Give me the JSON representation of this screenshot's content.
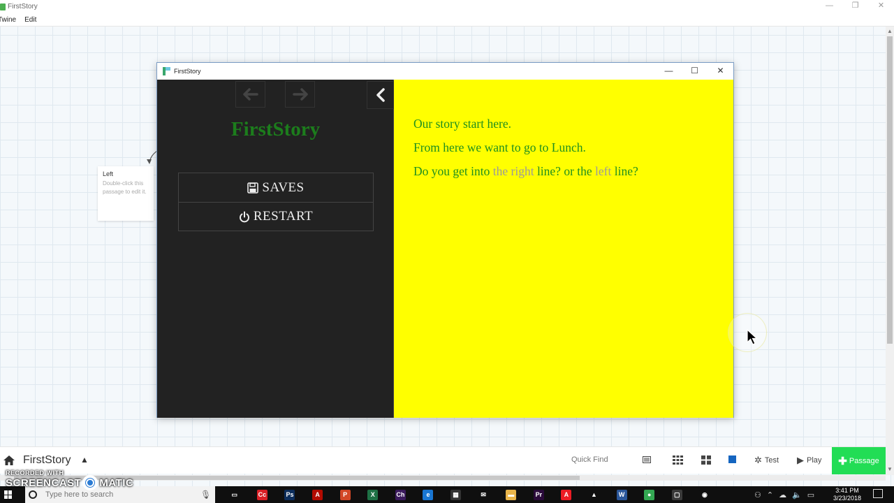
{
  "app": {
    "title": "FirstStory",
    "menu": [
      "Twine",
      "Edit"
    ],
    "window_controls": [
      "—",
      "❐",
      "✕"
    ]
  },
  "passage_card": {
    "title": "Left",
    "excerpt": "Double-click this passage to edit it."
  },
  "play_window": {
    "title": "FirstStory",
    "controls": [
      "—",
      "☐",
      "✕"
    ],
    "history": {
      "back_icon": "arrow-left-icon",
      "forward_icon": "arrow-right-icon",
      "stow_icon": "chevron-left-icon"
    },
    "story_title": "FirstStory",
    "menu": {
      "saves_label": "SAVES",
      "restart_label": "RESTART"
    },
    "passage": {
      "line1": "Our story start here.",
      "line2": "From here we want to go to Lunch.",
      "line3_a": "Do you get into ",
      "link_right": "the right",
      "line3_b": " line? or the ",
      "link_left": "left",
      "line3_c": " line?"
    },
    "colors": {
      "sidebar_bg": "#222222",
      "passage_bg": "#ffff00",
      "text": "#1f8f1f",
      "link": "#9a9a9a",
      "title": "#1c7d1c"
    }
  },
  "toolbar": {
    "story_name": "FirstStory",
    "quick_find_placeholder": "Quick Find",
    "test_label": "Test",
    "play_label": "Play",
    "passage_label": "Passage",
    "passage_color": "#22dd55"
  },
  "taskbar": {
    "search_placeholder": "Type here to search",
    "time": "3:41 PM",
    "date": "3/23/2018",
    "apps": [
      {
        "name": "task-view",
        "label": "▭",
        "color": "#0f0f0f"
      },
      {
        "name": "creative-cloud",
        "label": "Cc",
        "color": "#da1f26"
      },
      {
        "name": "photoshop",
        "label": "Ps",
        "color": "#0c2d5b"
      },
      {
        "name": "acrobat",
        "label": "A",
        "color": "#b30b00"
      },
      {
        "name": "powerpoint",
        "label": "P",
        "color": "#d24726"
      },
      {
        "name": "excel",
        "label": "X",
        "color": "#1e7145"
      },
      {
        "name": "character-animator",
        "label": "Ch",
        "color": "#3a1a5c"
      },
      {
        "name": "edge",
        "label": "e",
        "color": "#1976d2"
      },
      {
        "name": "calculator",
        "label": "▦",
        "color": "#333333"
      },
      {
        "name": "mail",
        "label": "✉",
        "color": "#0f0f0f"
      },
      {
        "name": "file-explorer",
        "label": "▬",
        "color": "#e8b44a"
      },
      {
        "name": "premiere",
        "label": "Pr",
        "color": "#2a0a3a"
      },
      {
        "name": "acrobat-dc",
        "label": "A",
        "color": "#ed1c24"
      },
      {
        "name": "photos",
        "label": "▲",
        "color": "#0f0f0f"
      },
      {
        "name": "word",
        "label": "W",
        "color": "#2b579a"
      },
      {
        "name": "chrome",
        "label": "●",
        "color": "#34a853"
      },
      {
        "name": "twine",
        "label": "▢",
        "color": "#3a3a3a"
      },
      {
        "name": "screencast",
        "label": "◉",
        "color": "#0f0f0f"
      }
    ]
  },
  "watermark": {
    "top": "RECORDED WITH",
    "main_a": "SCREENCAST",
    "main_b": "MATIC"
  }
}
